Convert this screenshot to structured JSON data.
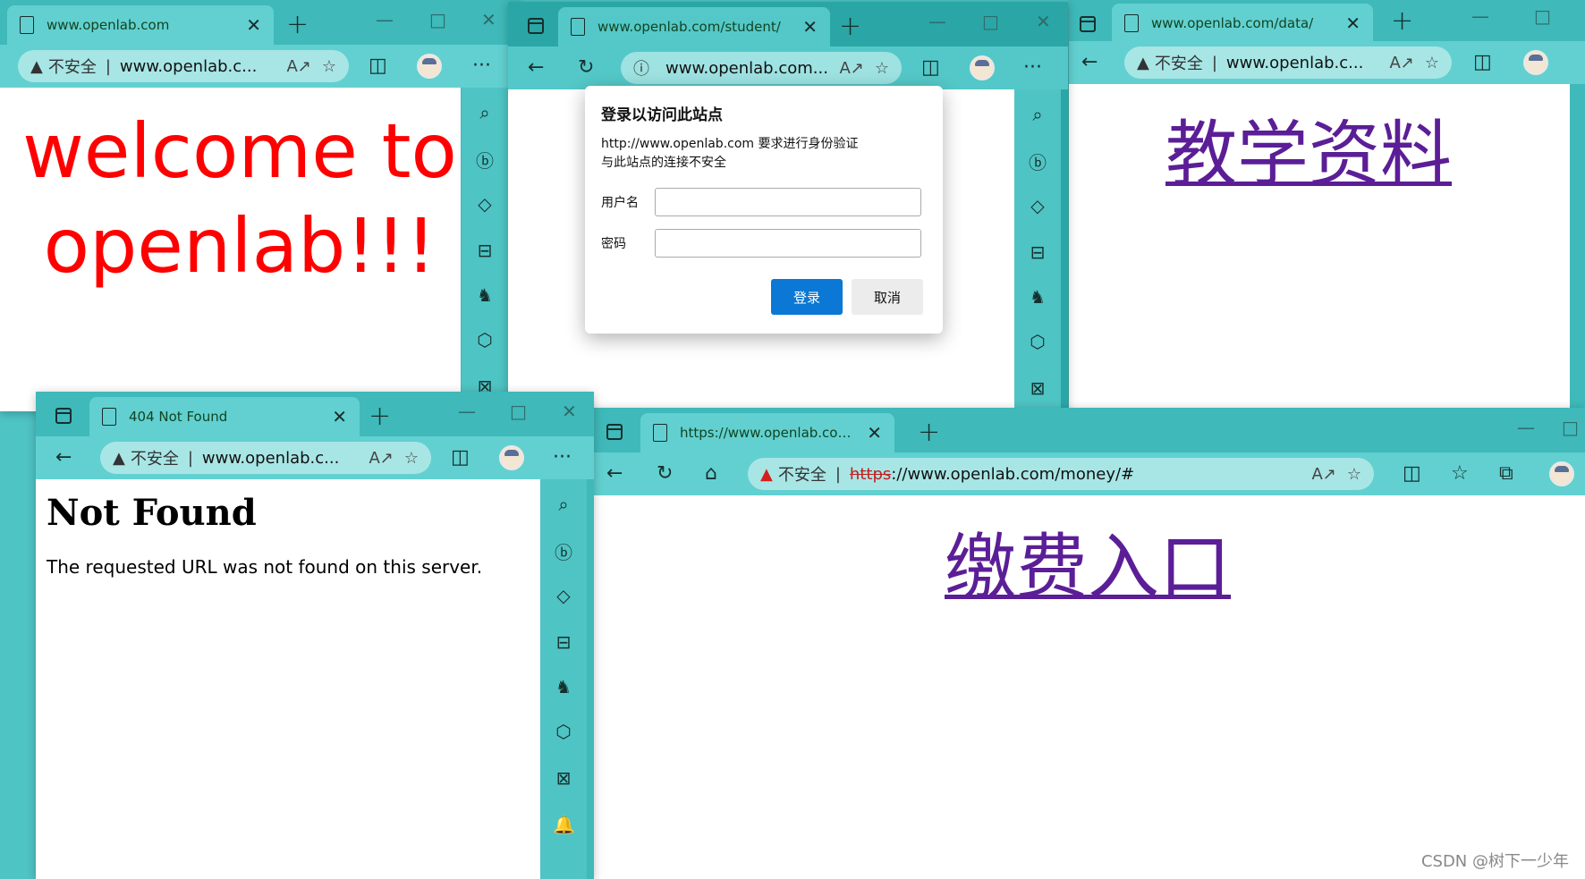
{
  "common": {
    "not_secure": "不安全",
    "new_tab_glyph": "+",
    "minimize_glyph": "—",
    "maximize_glyph": "□",
    "close_glyph": "✕",
    "tab_close_glyph": "✕",
    "more_glyph": "···",
    "sidebar_icons": [
      "search-icon",
      "bing-chat-icon",
      "shopping-tag-icon",
      "tools-icon",
      "games-icon",
      "office-icon",
      "outlook-icon",
      "bell-icon"
    ]
  },
  "win1": {
    "tab_title": "www.openlab.com",
    "address": "www.openlab.c...",
    "page_text": "welcome to openlab!!!"
  },
  "win2": {
    "tab_title": "www.openlab.com/student/",
    "address": "www.openlab.com..."
  },
  "dialog": {
    "title": "登录以访问此站点",
    "line1": "http://www.openlab.com 要求进行身份验证",
    "line2": "与此站点的连接不安全",
    "username_label": "用户名",
    "password_label": "密码",
    "login_button": "登录",
    "cancel_button": "取消"
  },
  "win3": {
    "tab_title": "www.openlab.com/data/",
    "address": "www.openlab.c...",
    "page_link": "教学资料"
  },
  "win4": {
    "tab_title": "404 Not Found",
    "address": "www.openlab.c...",
    "heading": "Not Found",
    "message": "The requested URL was not found on this server."
  },
  "win5": {
    "tab_title": "https://www.openlab.com/money/#",
    "address_scheme": "https",
    "address_rest": "://www.openlab.com/money/#",
    "page_link": "缴费入口"
  },
  "watermark": "CSDN @树下一少年",
  "colors": {
    "frame": "#4fc4c4",
    "welcome_red": "#ff0000",
    "visited_link": "#5b1e97",
    "login_blue": "#0a78d4"
  }
}
